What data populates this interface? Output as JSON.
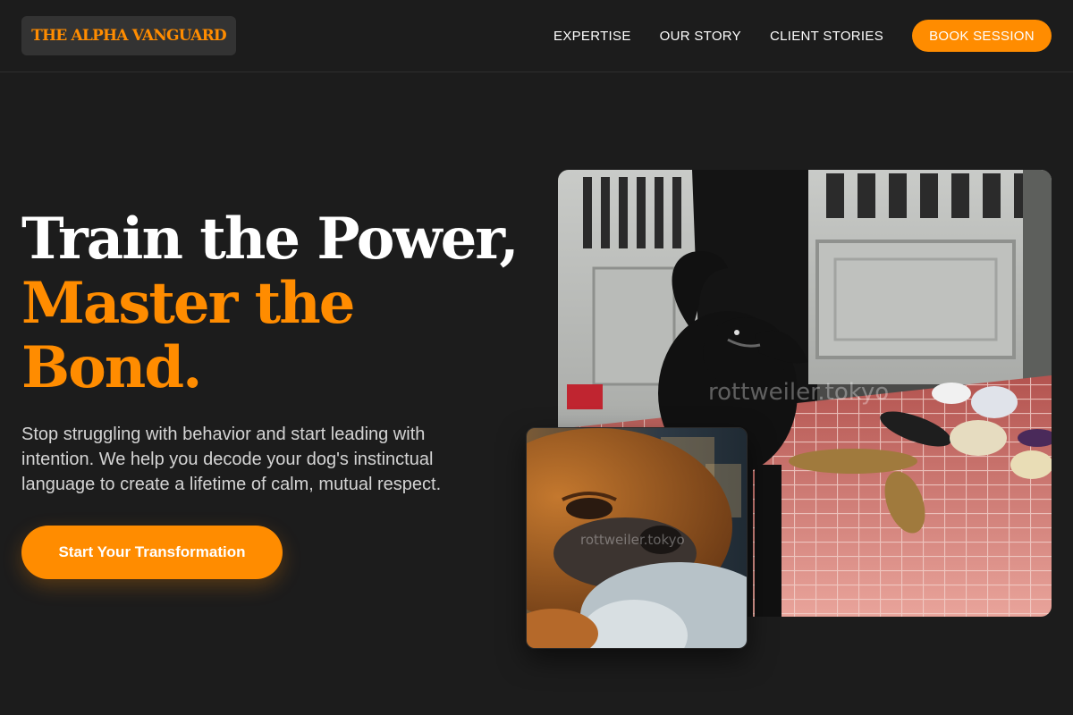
{
  "header": {
    "logo_text": "THE ALPHA VANGUARD",
    "nav": [
      {
        "label": "EXPERTISE"
      },
      {
        "label": "OUR STORY"
      },
      {
        "label": "CLIENT STORIES"
      }
    ],
    "cta_label": "BOOK SESSION"
  },
  "hero": {
    "title_line1": "Train the Power,",
    "title_line2": "Master the",
    "title_line3": "Bond.",
    "subtitle": "Stop struggling with behavior and start leading with intention. We help you decode your dog's instinctual language to create a lifetime of calm, mutual respect.",
    "cta_label": "Start Your Transformation"
  },
  "images": {
    "main_watermark": "rottweiler.tokyo",
    "small_watermark": "rottweiler.tokyo"
  },
  "colors": {
    "background": "#1c1c1c",
    "accent": "#ff8c00",
    "text_primary": "#ffffff",
    "text_secondary": "#d4d4d4",
    "logo_bg": "#333333"
  }
}
